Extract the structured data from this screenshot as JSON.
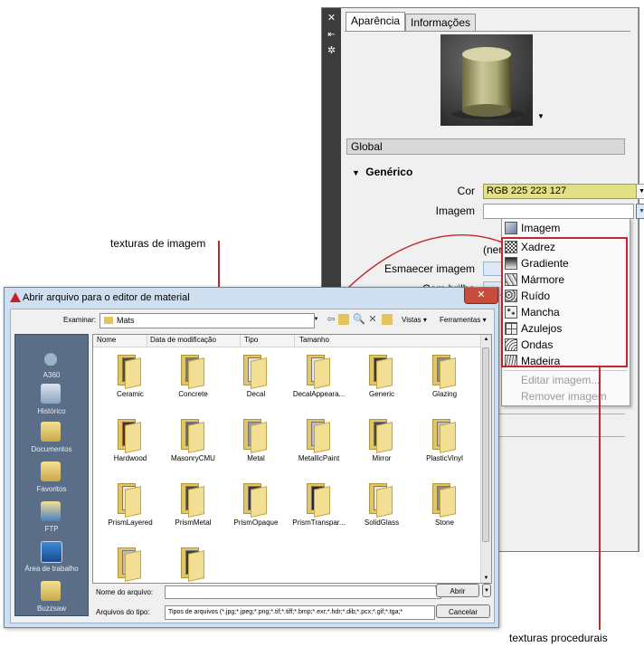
{
  "material_editor": {
    "tabs": [
      "Aparência",
      "Informações"
    ],
    "section_global": "Global",
    "section_generic": "Genérico",
    "labels": {
      "cor": "Cor",
      "imagem": "Imagem",
      "none": "(nenhu",
      "esmaecer": "Esmaecer imagem",
      "brilho": "Com brilho"
    },
    "cor_value": "RGB 225 223 127",
    "cor_color": "#e2df86"
  },
  "dropdown": {
    "items": [
      {
        "label": "Imagem",
        "icon": "image-icon",
        "enabled": true
      },
      {
        "label": "Xadrez",
        "icon": "checker-icon",
        "enabled": true
      },
      {
        "label": "Gradiente",
        "icon": "gradient-icon",
        "enabled": true
      },
      {
        "label": "Mármore",
        "icon": "marble-icon",
        "enabled": true
      },
      {
        "label": "Ruído",
        "icon": "noise-icon",
        "enabled": true
      },
      {
        "label": "Mancha",
        "icon": "speckle-icon",
        "enabled": true
      },
      {
        "label": "Azulejos",
        "icon": "tiles-icon",
        "enabled": true
      },
      {
        "label": "Ondas",
        "icon": "waves-icon",
        "enabled": true
      },
      {
        "label": "Madeira",
        "icon": "wood-icon",
        "enabled": true
      },
      {
        "label": "Editar imagem...",
        "icon": "",
        "enabled": false
      },
      {
        "label": "Remover imagem",
        "icon": "",
        "enabled": false
      }
    ]
  },
  "annotations": {
    "image_textures": "texturas de imagem",
    "procedural_textures": "texturas procedurais",
    "accent_color": "#c1272d"
  },
  "dialog": {
    "title": "Abrir arquivo para o editor de material",
    "examinar_label": "Examinar:",
    "current_folder": "Mats",
    "toolbar": {
      "vistas": "Vistas",
      "ferramentas": "Ferramentas"
    },
    "places": [
      "A360",
      "Histórico",
      "Documentos",
      "Favoritos",
      "FTP",
      "Área de trabalho",
      "Buzzsaw"
    ],
    "columns": [
      "Nome",
      "Data de modificação",
      "Tipo",
      "Tamanho"
    ],
    "folders": [
      {
        "name": "Ceramic",
        "doc_color": "#4a4a4a"
      },
      {
        "name": "Concrete",
        "doc_color": "#7a7a7a"
      },
      {
        "name": "Decal",
        "doc_color": "#e9e9e9"
      },
      {
        "name": "DecalAppeara...",
        "doc_color": "#e9e9e9"
      },
      {
        "name": "Generic",
        "doc_color": "#3a3a3a"
      },
      {
        "name": "Glazing",
        "doc_color": "#8a8a8a"
      },
      {
        "name": "Hardwood",
        "doc_color": "#5a2a1a"
      },
      {
        "name": "MasonryCMU",
        "doc_color": "#6a6a6a"
      },
      {
        "name": "Metal",
        "doc_color": "#9a9a9a"
      },
      {
        "name": "MetallicPaint",
        "doc_color": "#bdbdbd"
      },
      {
        "name": "Mirror",
        "doc_color": "#4a4a4a"
      },
      {
        "name": "PlasticVinyl",
        "doc_color": "#bdbdbd"
      },
      {
        "name": "PrismLayered",
        "doc_color": "#e9e9e9"
      },
      {
        "name": "PrismMetal",
        "doc_color": "#4a4a4a"
      },
      {
        "name": "PrismOpaque",
        "doc_color": "#3a3a3a"
      },
      {
        "name": "PrismTranspar...",
        "doc_color": "#2a2a2a"
      },
      {
        "name": "SolidGlass",
        "doc_color": "#e9e9e9"
      },
      {
        "name": "Stone",
        "doc_color": "#8a8a8a"
      },
      {
        "name": "",
        "doc_color": "#bdbdbd"
      },
      {
        "name": "",
        "doc_color": "#3a3a3a"
      }
    ],
    "filename_label": "Nome do arquivo:",
    "filename_value": "",
    "filetype_label": "Arquivos do tipo:",
    "filetype_value": "Tipos de arquivos (*.jpg;*.jpeg;*.png;*.tif;*.tiff;*.bmp;*.exr;*.hdr;*.dib;*.pcx;*.gif;*.tga;*",
    "open_button": "Abrir",
    "cancel_button": "Cancelar"
  }
}
